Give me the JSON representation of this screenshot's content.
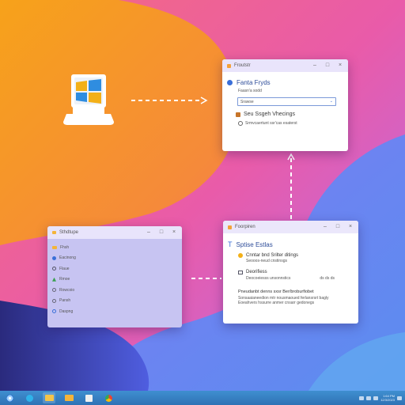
{
  "colors": {
    "accent": "#3a6fd8",
    "taskbar": "#3f8fd0",
    "explorer_panel": "#c7c4f2",
    "window_title_tint": "#eae6fb"
  },
  "computer_icon": {
    "name": "windows-laptop-icon"
  },
  "top_window": {
    "title": "Froutstr",
    "controls": [
      "–",
      "□",
      "×"
    ],
    "heading": "Fanta Fryds",
    "subtitle": "Faasn'a sodd",
    "dropdown_value": "Srawse",
    "section_title": "Seu Ssgeh Vhecings",
    "section_text": "Srmvcaertunt ssr'cas esaterst"
  },
  "explorer_window": {
    "title": "Sthdtupe",
    "controls": [
      "–",
      "□",
      "×"
    ],
    "items": [
      {
        "label": "Fhsh",
        "icon": "folder-icon"
      },
      {
        "label": "Eacinong",
        "icon": "globe-icon"
      },
      {
        "label": "Flaue",
        "icon": "gear-icon"
      },
      {
        "label": "Rmoe",
        "icon": "tree-icon"
      },
      {
        "label": "Rowcoio",
        "icon": "settings-icon"
      },
      {
        "label": "Pansh",
        "icon": "clock-icon"
      },
      {
        "label": "Daspng",
        "icon": "power-icon"
      }
    ]
  },
  "settings_window": {
    "title": "Foorpiren",
    "controls": [
      "–",
      "□",
      "×"
    ],
    "heading": "Sptise Estlas",
    "row1_title": "Cnntar bnd Srilter ditings",
    "row1_sub": "Seooos-neud cnstinsgs",
    "row2_title": "Deorifiess",
    "row2_sub": "Deocoeiesss unsonnstics",
    "row2_right": "ds  ds ds",
    "para_title": "Pneudanbt denns sxsr Ber/broburfiobet",
    "para_line1": "Sonsaaianeedion mtr nousmaoued ferlansrsrt bagly",
    "para_line2": "Eoeahvers hssurre anmer cnsarr gedonegs"
  },
  "taskbar": {
    "buttons": [
      {
        "name": "start-icon"
      },
      {
        "name": "edge-icon"
      },
      {
        "name": "file-explorer-icon"
      },
      {
        "name": "folder-icon"
      },
      {
        "name": "store-icon"
      },
      {
        "name": "chrome-icon"
      }
    ],
    "tray_time": "1:64 PM",
    "tray_date": "12/3/2023"
  }
}
